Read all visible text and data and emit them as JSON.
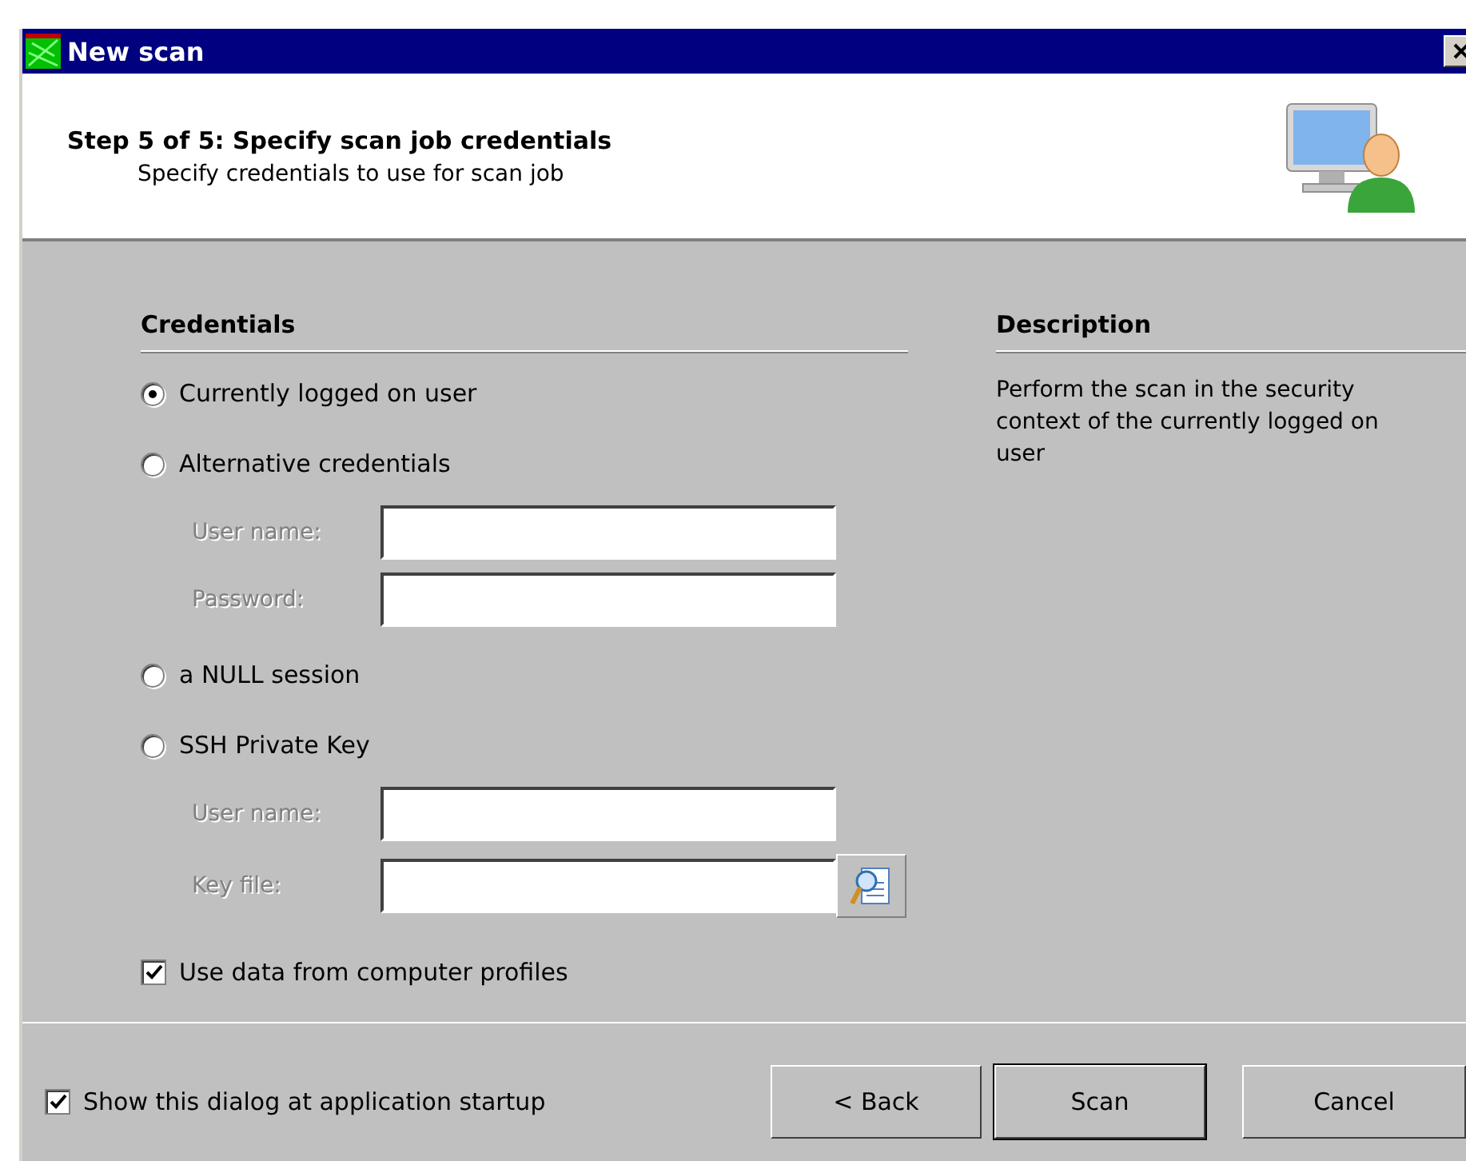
{
  "window": {
    "title": "New scan"
  },
  "header": {
    "title": "Step 5 of 5: Specify scan job credentials",
    "subtitle": "Specify credentials to use for scan job"
  },
  "credentials": {
    "heading": "Credentials",
    "options": [
      {
        "label": "Currently logged on user",
        "selected": true
      },
      {
        "label": "Alternative credentials",
        "selected": false,
        "fields": [
          {
            "label": "User name:",
            "disabled": true
          },
          {
            "label": "Password:",
            "disabled": true
          }
        ]
      },
      {
        "label": "a NULL session",
        "selected": false
      },
      {
        "label": "SSH Private Key",
        "selected": false,
        "fields": [
          {
            "label": "User name:",
            "disabled": true
          },
          {
            "label": "Key file:",
            "disabled": true,
            "kind": "browse"
          }
        ]
      }
    ],
    "profiles_checkbox": {
      "label": "Use data from computer profiles",
      "checked": true
    }
  },
  "description": {
    "heading": "Description",
    "text": "Perform the scan in the security context of the currently logged on user"
  },
  "footer": {
    "startup_checkbox": {
      "label": "Show this dialog at application startup",
      "checked": true
    },
    "buttons": [
      {
        "label": "< Back",
        "default": false
      },
      {
        "label": "Scan",
        "default": true
      },
      {
        "label": "Cancel",
        "default": false
      }
    ]
  }
}
